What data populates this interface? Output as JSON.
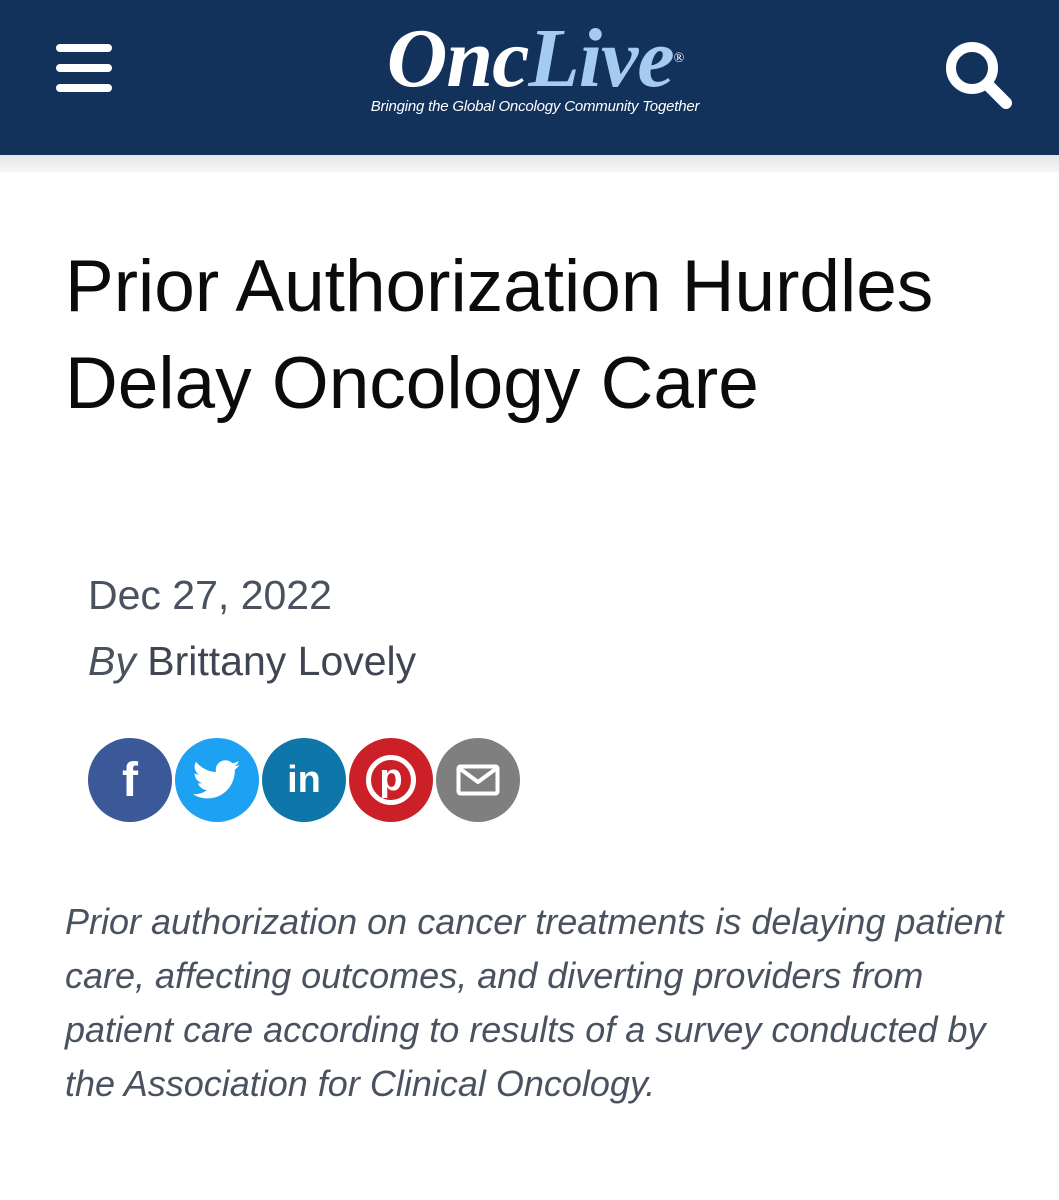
{
  "header": {
    "background_color": "#12325c",
    "menu_icon": "hamburger-menu-icon",
    "search_icon": "search-icon",
    "logo": {
      "part1": "Onc",
      "part2": "Live",
      "registered": "®",
      "tagline": "Bringing the Global Oncology Community Together",
      "colors": {
        "part1": "#ffffff",
        "part2": "#a6cbf0"
      }
    }
  },
  "article": {
    "title": "Prior Authorization Hurdles Delay Oncology Care",
    "date": "Dec 27, 2022",
    "byline_prefix": "By",
    "author": "Brittany Lovely",
    "summary": "Prior authorization on cancer treatments is delaying patient care, affecting outcomes, and diverting providers from patient care according to results of a survey conducted by the Association for Clinical Oncology."
  },
  "share": [
    {
      "network": "facebook",
      "icon": "facebook-icon",
      "glyph": "f",
      "color": "#3b5998"
    },
    {
      "network": "twitter",
      "icon": "twitter-icon",
      "glyph": "",
      "color": "#1da1f2"
    },
    {
      "network": "linkedin",
      "icon": "linkedin-icon",
      "glyph": "in",
      "color": "#0e76a8"
    },
    {
      "network": "pinterest",
      "icon": "pinterest-icon",
      "glyph": "p",
      "color": "#cb2027"
    },
    {
      "network": "email",
      "icon": "email-icon",
      "glyph": "",
      "color": "#7f7f7f"
    }
  ]
}
